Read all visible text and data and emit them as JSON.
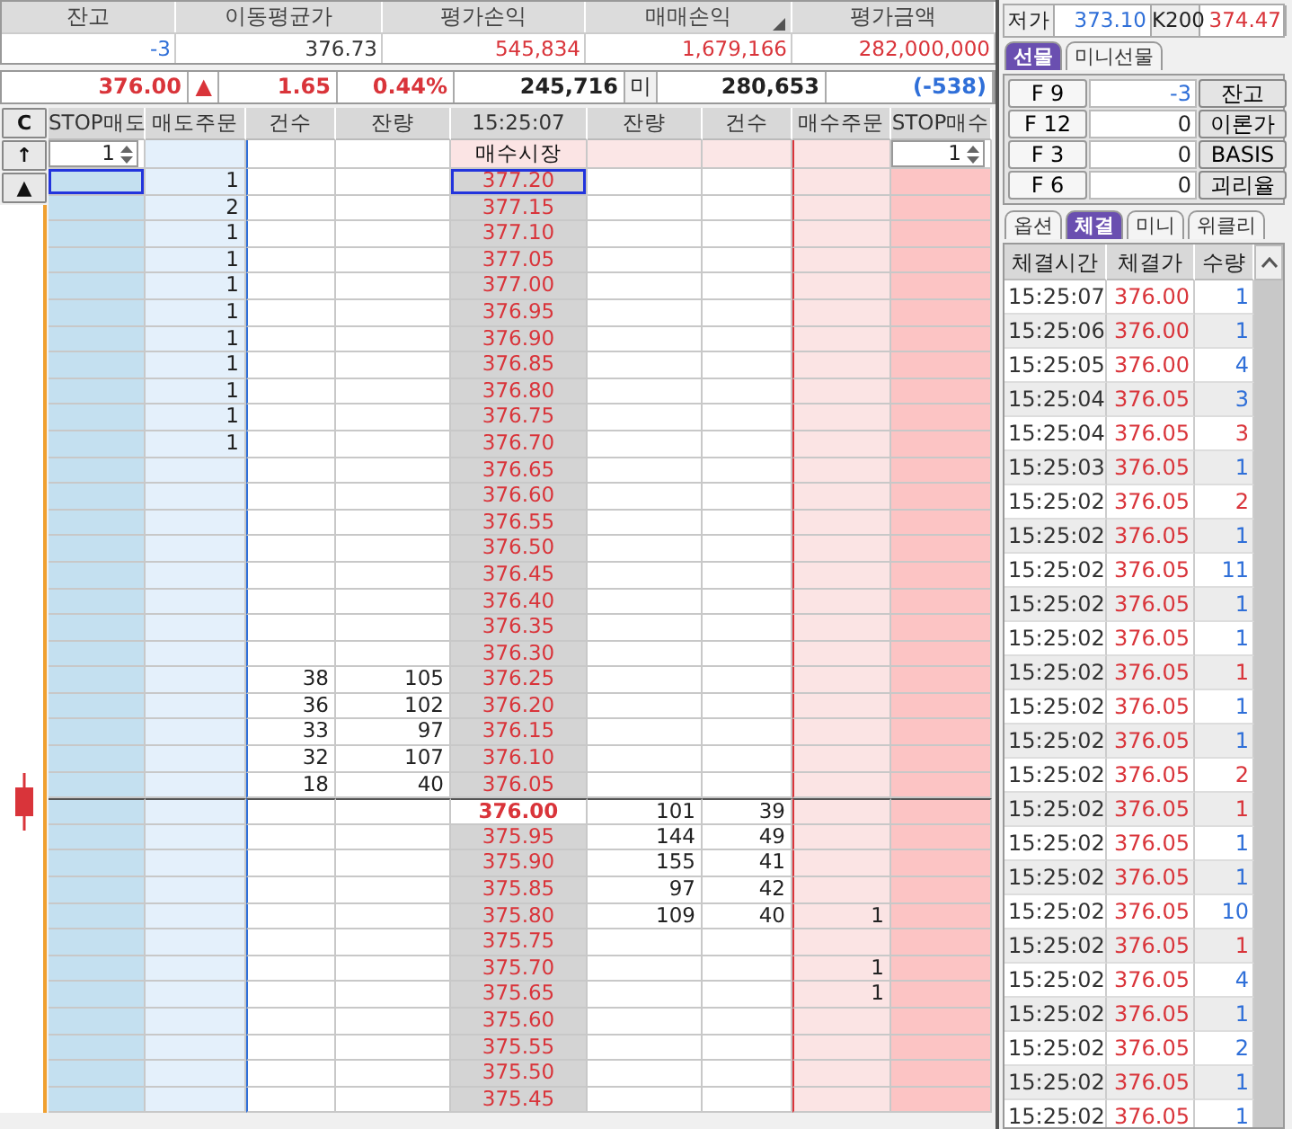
{
  "summary": [
    {
      "label": "잔고",
      "value": "-3",
      "color": "#2f6fd8"
    },
    {
      "label": "이동평균가",
      "value": "376.73",
      "color": "#333333"
    },
    {
      "label": "평가손익",
      "value": "545,834",
      "color": "#d9343a"
    },
    {
      "label": "매매손익",
      "value": "1,679,166",
      "color": "#d9343a"
    },
    {
      "label": "평가금액",
      "value": "282,000,000",
      "color": "#d9343a"
    }
  ],
  "quote": [
    {
      "kind": "value",
      "text": "376.00",
      "color": "#d9343a"
    },
    {
      "kind": "value",
      "text": "▲",
      "color": "#d9343a"
    },
    {
      "kind": "value",
      "text": "1.65",
      "color": "#d9343a"
    },
    {
      "kind": "value",
      "text": "0.44%",
      "color": "#d9343a"
    },
    {
      "kind": "value",
      "text": "245,716",
      "color": "#222222"
    },
    {
      "kind": "label",
      "text": "미",
      "color": "#222222"
    },
    {
      "kind": "value",
      "text": "280,653",
      "color": "#222222"
    },
    {
      "kind": "value",
      "text": "(-538)",
      "color": "#2f6fd8"
    }
  ],
  "book": {
    "clear_button": "C",
    "up_button": "↑",
    "top_button": "▲",
    "columns": [
      "STOP매도",
      "매도주문",
      "건수",
      "잔량",
      "15:25:07",
      "잔량",
      "건수",
      "매수주문",
      "STOP매수"
    ],
    "stop_sell_qty": "1",
    "market_buy": "매수시장",
    "stop_buy_qty": "1",
    "rows": [
      {
        "price": "377.20",
        "sell_order": "1",
        "selected": true,
        "current": false
      },
      {
        "price": "377.15",
        "sell_order": "2",
        "selected": false,
        "current": false
      },
      {
        "price": "377.10",
        "sell_order": "1",
        "selected": false,
        "current": false
      },
      {
        "price": "377.05",
        "sell_order": "1",
        "selected": false,
        "current": false
      },
      {
        "price": "377.00",
        "sell_order": "1",
        "selected": false,
        "current": false
      },
      {
        "price": "376.95",
        "sell_order": "1",
        "selected": false,
        "current": false
      },
      {
        "price": "376.90",
        "sell_order": "1",
        "selected": false,
        "current": false
      },
      {
        "price": "376.85",
        "sell_order": "1",
        "selected": false,
        "current": false
      },
      {
        "price": "376.80",
        "sell_order": "1",
        "selected": false,
        "current": false
      },
      {
        "price": "376.75",
        "sell_order": "1",
        "selected": false,
        "current": false
      },
      {
        "price": "376.70",
        "sell_order": "1",
        "selected": false,
        "current": false
      },
      {
        "price": "376.65",
        "selected": false,
        "current": false
      },
      {
        "price": "376.60",
        "selected": false,
        "current": false
      },
      {
        "price": "376.55",
        "selected": false,
        "current": false
      },
      {
        "price": "376.50",
        "selected": false,
        "current": false
      },
      {
        "price": "376.45",
        "selected": false,
        "current": false
      },
      {
        "price": "376.40",
        "selected": false,
        "current": false
      },
      {
        "price": "376.35",
        "selected": false,
        "current": false
      },
      {
        "price": "376.30",
        "selected": false,
        "current": false
      },
      {
        "price": "376.25",
        "ask_count": "38",
        "ask_qty": "105",
        "selected": false,
        "current": false
      },
      {
        "price": "376.20",
        "ask_count": "36",
        "ask_qty": "102",
        "selected": false,
        "current": false
      },
      {
        "price": "376.15",
        "ask_count": "33",
        "ask_qty": "97",
        "selected": false,
        "current": false
      },
      {
        "price": "376.10",
        "ask_count": "32",
        "ask_qty": "107",
        "selected": false,
        "current": false
      },
      {
        "price": "376.05",
        "ask_count": "18",
        "ask_qty": "40",
        "selected": false,
        "current": false
      },
      {
        "price": "376.00",
        "bid_qty": "101",
        "bid_count": "39",
        "selected": false,
        "current": true
      },
      {
        "price": "375.95",
        "bid_qty": "144",
        "bid_count": "49",
        "selected": false,
        "current": false
      },
      {
        "price": "375.90",
        "bid_qty": "155",
        "bid_count": "41",
        "selected": false,
        "current": false
      },
      {
        "price": "375.85",
        "bid_qty": "97",
        "bid_count": "42",
        "selected": false,
        "current": false
      },
      {
        "price": "375.80",
        "bid_qty": "109",
        "bid_count": "40",
        "buy_order": "1",
        "selected": false,
        "current": false
      },
      {
        "price": "375.75",
        "selected": false,
        "current": false
      },
      {
        "price": "375.70",
        "buy_order": "1",
        "selected": false,
        "current": false
      },
      {
        "price": "375.65",
        "buy_order": "1",
        "selected": false,
        "current": false
      },
      {
        "price": "375.60",
        "selected": false,
        "current": false
      },
      {
        "price": "375.55",
        "selected": false,
        "current": false
      },
      {
        "price": "375.50",
        "selected": false,
        "current": false
      },
      {
        "price": "375.45",
        "selected": false,
        "current": false
      }
    ]
  },
  "side": {
    "stats": [
      {
        "kind": "label",
        "text": "저가",
        "color": "#222222"
      },
      {
        "kind": "value",
        "text": "373.10",
        "color": "#2f6fd8"
      },
      {
        "kind": "label",
        "text": "K200",
        "color": "#222222"
      },
      {
        "kind": "value",
        "text": "374.47",
        "color": "#d9343a"
      }
    ],
    "product_tabs": [
      {
        "label": "선물",
        "selected": true
      },
      {
        "label": "미니선물",
        "selected": false
      }
    ],
    "futures": [
      {
        "code": "F 9",
        "value": "-3",
        "color": "#2f6fd8",
        "action": "잔고"
      },
      {
        "code": "F 12",
        "value": "0",
        "color": "#222222",
        "action": "이론가"
      },
      {
        "code": "F 3",
        "value": "0",
        "color": "#222222",
        "action": "BASIS"
      },
      {
        "code": "F 6",
        "value": "0",
        "color": "#222222",
        "action": "괴리율"
      }
    ],
    "view_tabs": [
      {
        "label": "옵션",
        "selected": false
      },
      {
        "label": "체결",
        "selected": true
      },
      {
        "label": "미니",
        "selected": false
      },
      {
        "label": "위클리",
        "selected": false
      }
    ],
    "trade_columns": [
      "체결시간",
      "체결가",
      "수량"
    ],
    "trades": [
      {
        "time": "15:25:07",
        "price": "376.00",
        "qty": "1",
        "color": "#2f6fd8"
      },
      {
        "time": "15:25:06",
        "price": "376.00",
        "qty": "1",
        "color": "#2f6fd8"
      },
      {
        "time": "15:25:05",
        "price": "376.00",
        "qty": "4",
        "color": "#2f6fd8"
      },
      {
        "time": "15:25:04",
        "price": "376.05",
        "qty": "3",
        "color": "#2f6fd8"
      },
      {
        "time": "15:25:04",
        "price": "376.05",
        "qty": "3",
        "color": "#d9343a"
      },
      {
        "time": "15:25:03",
        "price": "376.05",
        "qty": "1",
        "color": "#2f6fd8"
      },
      {
        "time": "15:25:02",
        "price": "376.05",
        "qty": "2",
        "color": "#d9343a"
      },
      {
        "time": "15:25:02",
        "price": "376.05",
        "qty": "1",
        "color": "#2f6fd8"
      },
      {
        "time": "15:25:02",
        "price": "376.05",
        "qty": "11",
        "color": "#2f6fd8"
      },
      {
        "time": "15:25:02",
        "price": "376.05",
        "qty": "1",
        "color": "#2f6fd8"
      },
      {
        "time": "15:25:02",
        "price": "376.05",
        "qty": "1",
        "color": "#2f6fd8"
      },
      {
        "time": "15:25:02",
        "price": "376.05",
        "qty": "1",
        "color": "#d9343a"
      },
      {
        "time": "15:25:02",
        "price": "376.05",
        "qty": "1",
        "color": "#2f6fd8"
      },
      {
        "time": "15:25:02",
        "price": "376.05",
        "qty": "1",
        "color": "#2f6fd8"
      },
      {
        "time": "15:25:02",
        "price": "376.05",
        "qty": "2",
        "color": "#d9343a"
      },
      {
        "time": "15:25:02",
        "price": "376.05",
        "qty": "1",
        "color": "#d9343a"
      },
      {
        "time": "15:25:02",
        "price": "376.05",
        "qty": "1",
        "color": "#2f6fd8"
      },
      {
        "time": "15:25:02",
        "price": "376.05",
        "qty": "1",
        "color": "#2f6fd8"
      },
      {
        "time": "15:25:02",
        "price": "376.05",
        "qty": "10",
        "color": "#2f6fd8"
      },
      {
        "time": "15:25:02",
        "price": "376.05",
        "qty": "1",
        "color": "#d9343a"
      },
      {
        "time": "15:25:02",
        "price": "376.05",
        "qty": "4",
        "color": "#2f6fd8"
      },
      {
        "time": "15:25:02",
        "price": "376.05",
        "qty": "1",
        "color": "#2f6fd8"
      },
      {
        "time": "15:25:02",
        "price": "376.05",
        "qty": "2",
        "color": "#2f6fd8"
      },
      {
        "time": "15:25:02",
        "price": "376.05",
        "qty": "1",
        "color": "#2f6fd8"
      },
      {
        "time": "15:25:02",
        "price": "376.05",
        "qty": "1",
        "color": "#2f6fd8"
      }
    ]
  }
}
